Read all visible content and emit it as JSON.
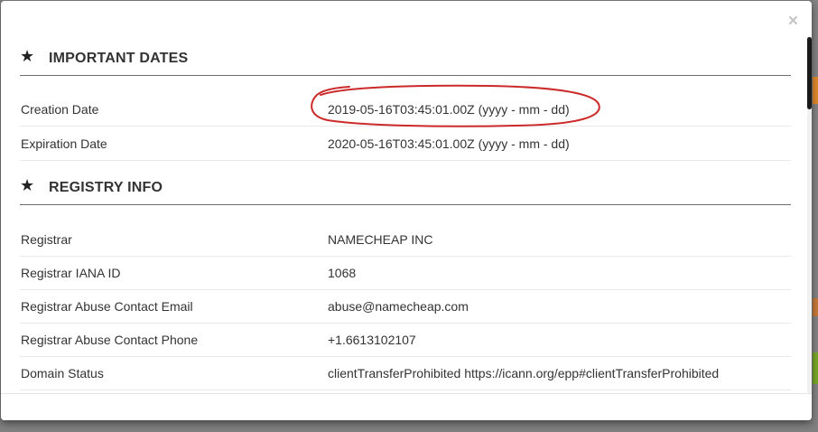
{
  "modal": {
    "close_label": "×"
  },
  "sections": [
    {
      "title": "IMPORTANT DATES",
      "rows": [
        {
          "label": "Creation Date",
          "value": "2019-05-16T03:45:01.00Z (yyyy - mm - dd)"
        },
        {
          "label": "Expiration Date",
          "value": "2020-05-16T03:45:01.00Z (yyyy - mm - dd)"
        }
      ]
    },
    {
      "title": "REGISTRY INFO",
      "rows": [
        {
          "label": "Registrar",
          "value": "NAMECHEAP INC"
        },
        {
          "label": "Registrar IANA ID",
          "value": "1068"
        },
        {
          "label": "Registrar Abuse Contact Email",
          "value": "abuse@namecheap.com"
        },
        {
          "label": "Registrar Abuse Contact Phone",
          "value": "+1.6613102107"
        },
        {
          "label": "Domain Status",
          "value": "clientTransferProhibited https://icann.org/epp#clientTransferProhibited"
        }
      ]
    }
  ],
  "icons": {
    "section": "star-icon",
    "close": "close-icon"
  },
  "colors": {
    "annotation": "#cc2a2a",
    "accent_orange": "#e08a2c",
    "accent_green": "#7aa82a",
    "scrollbar_thumb": "#1a1a1a"
  }
}
